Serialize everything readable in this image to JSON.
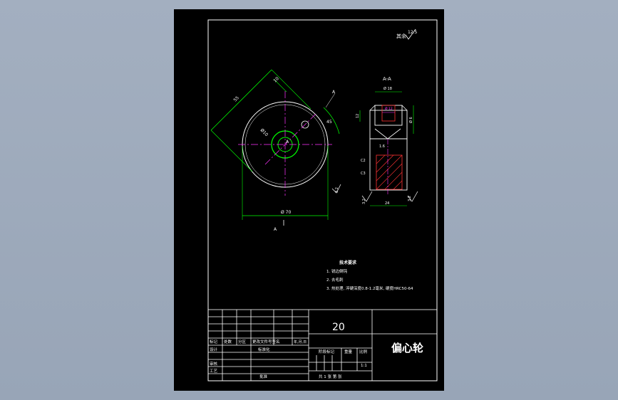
{
  "drawing": {
    "roughness_label": "其余",
    "roughness_value": "12.5",
    "section_title": "A-A",
    "view_label_bottom": "A",
    "view_label_top": "A",
    "dim_diagonal": "55",
    "dim_slot": "10",
    "dim_bore": "Ø10",
    "dim_angle_marker": "A",
    "dim_ra_left": "3.2",
    "dim_diameter_main": "Ø 70",
    "dim_side_label": "45",
    "dim_section_top": "Ø 18",
    "dim_section_left": "12",
    "dim_section_hole": "Ø 12",
    "dim_section_right": "Ø 6",
    "dim_section_left_a": "C2",
    "dim_section_left_b": "C3",
    "dim_section_inner": "1.6",
    "dim_section_ra": "3.2",
    "dim_section_ra2": "3.2",
    "dim_section_width": "24"
  },
  "notes": {
    "title": "技术要求",
    "items": [
      "1. 锐边倒钝",
      "2. 去毛刺",
      "3. 热处理, 淬硬深度0.8-1.2毫米, 硬度HRC50-64"
    ]
  },
  "titleblock": {
    "quantity": "20",
    "part_name": "偏心轮",
    "hdr_mark": "标记",
    "hdr_count": "处数",
    "hdr_zone": "分区",
    "hdr_docno": "更改文件号签名",
    "hdr_date": "年,月,日",
    "row_design": "设计",
    "row_standard": "标准化",
    "row_check": "审核",
    "row_process": "工艺",
    "row_approve": "批准",
    "stage_mark": "阶段标记",
    "weight": "重量",
    "scale": "比例",
    "scale_value": "1:1",
    "sheets": "共 1 张   第   张"
  }
}
